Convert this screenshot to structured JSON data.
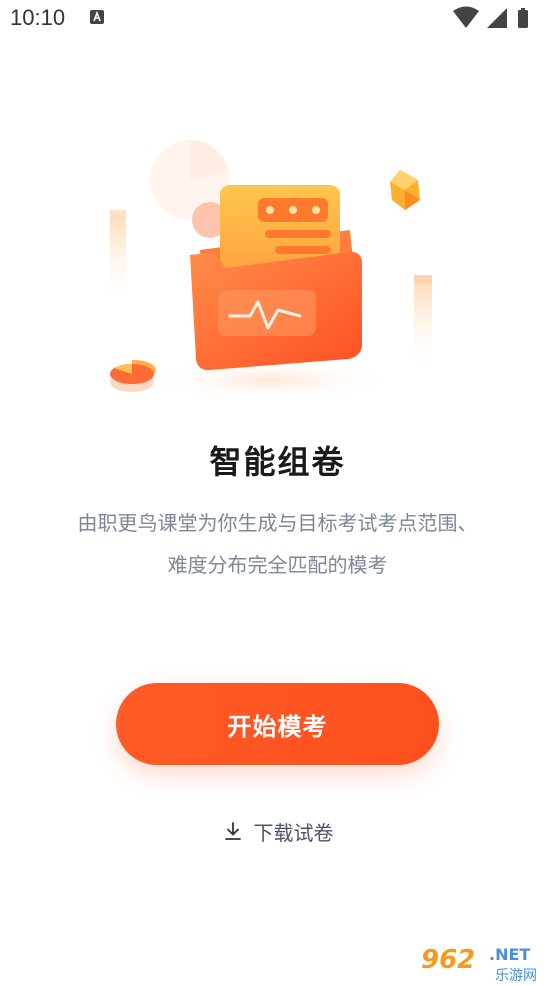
{
  "status_bar": {
    "time": "10:10",
    "left_icon": "a-notification-icon",
    "right_icons": [
      "wifi-icon",
      "signal-icon",
      "battery-icon"
    ]
  },
  "illustration": {
    "name": "folder-with-document-illustration",
    "colors": {
      "primary": "#ff5b27",
      "secondary": "#ffb24a"
    }
  },
  "content": {
    "title": "智能组卷",
    "description_line1": "由职更鸟课堂为你生成与目标考试考点范围、",
    "description_line2": "难度分布完全匹配的模考"
  },
  "actions": {
    "start_label": "开始模考",
    "download_label": "下载试卷",
    "download_icon": "download-icon"
  },
  "watermark": {
    "number": "962",
    "net": ".NET",
    "cn": "乐游网"
  },
  "colors": {
    "accent": "#ff5b27",
    "text_primary": "#1a1a1a",
    "text_secondary": "#7e8798"
  }
}
